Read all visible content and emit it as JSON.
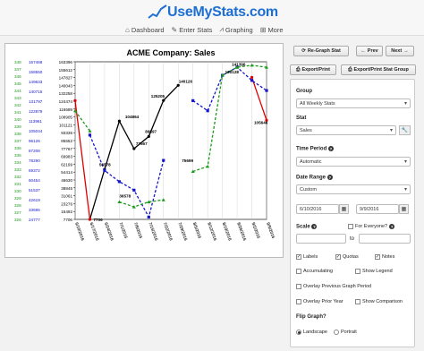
{
  "brand": {
    "name": "UseMyStats.com",
    "color": "#1d6fd1"
  },
  "nav": [
    {
      "label": "Dashboard",
      "icon": "home-icon"
    },
    {
      "label": "Enter Stats",
      "icon": "edit-icon"
    },
    {
      "label": "Graphing",
      "icon": "chart-icon"
    },
    {
      "label": "More",
      "icon": "plus-icon"
    }
  ],
  "toolbar": {
    "regraph": "Re-Graph Stat",
    "prev": "Prev",
    "next": "Next",
    "export_print": "Export/Print",
    "export_group": "Export/Print Stat Group"
  },
  "form": {
    "group_label": "Group",
    "group_value": "All Weekly Stats",
    "stat_label": "Stat",
    "stat_value": "Sales",
    "time_period_label": "Time Period",
    "time_period_value": "Automatic",
    "date_range_label": "Date Range",
    "date_range_value": "Custom",
    "date_from": "6/10/2016",
    "date_to": "9/9/2016",
    "scale_label": "Scale",
    "for_everyone_label": "For Everyone?",
    "scale_to": "to",
    "labels": "Labels",
    "quotas": "Quotas",
    "notes": "Notes",
    "accumulating": "Accumulating",
    "show_legend": "Show Legend",
    "overlay_prev": "Overlay Previous Graph Period",
    "overlay_prior_year": "Overlay Prior Year",
    "show_comparison": "Show Comparison",
    "flip_graph": "Flip Graph?",
    "landscape": "Landscape",
    "portrait": "Portrait"
  },
  "chart_data": {
    "type": "line",
    "title": "ACME Company: Sales",
    "categories": [
      "6/10/2016",
      "6/17/2016",
      "6/24/2016",
      "7/1/2016",
      "7/8/2016",
      "7/15/2016",
      "7/22/2016",
      "7/29/2016",
      "8/5/2016",
      "8/12/2016",
      "8/19/2016",
      "8/26/2016",
      "9/2/2016",
      "9/9/2016"
    ],
    "ylim": [
      7706,
      163396
    ],
    "yticks_main": [
      "163396",
      "155612",
      "147827",
      "140043",
      "132258",
      "124474",
      "116689",
      "108905",
      "101121",
      "93336",
      "85552",
      "77767",
      "69983",
      "62199",
      "54414",
      "46630",
      "38845",
      "31061",
      "23276",
      "15492",
      "7706"
    ],
    "yticks_left1": [
      "24777",
      "33695",
      "42619",
      "51537",
      "60454",
      "69372",
      "78290",
      "87208",
      "96126",
      "105044",
      "113961",
      "122879",
      "131797",
      "140715",
      "149633",
      "158550",
      "167468"
    ],
    "yticks_left2": [
      "348",
      "347",
      "346",
      "345",
      "344",
      "343",
      "342",
      "341",
      "340",
      "339",
      "338",
      "337",
      "336",
      "335",
      "334",
      "333",
      "332",
      "331",
      "330",
      "329",
      "328",
      "327",
      "326"
    ],
    "series": [
      {
        "name": "",
        "color": "#000000",
        "style": "solid",
        "values": [
          null,
          7706,
          57000,
          104864,
          77567,
          89597,
          125205,
          140126,
          null,
          null,
          null,
          null,
          null,
          null
        ]
      },
      {
        "name": "",
        "color": "#e00000",
        "style": "solid",
        "values": [
          125000,
          7706,
          null,
          null,
          null,
          null,
          null,
          null,
          null,
          null,
          null,
          null,
          148000,
          105646
        ]
      },
      {
        "name": "",
        "color": "#1515cc",
        "style": "dashed",
        "values": [
          null,
          91000,
          56000,
          45000,
          36578,
          10000,
          66000,
          null,
          125000,
          115000,
          150000,
          158000,
          145000,
          135000
        ]
      },
      {
        "name": "",
        "color": "#1a9a1a",
        "style": "dashed",
        "values": [
          115000,
          95000,
          null,
          25000,
          20000,
          25000,
          27000,
          null,
          55000,
          60000,
          150000,
          158000,
          160000,
          158000
        ]
      }
    ],
    "labels": {
      "l1": "160128",
      "l2": "107964",
      "l3": "104864",
      "l4": "125205",
      "l5": "140126",
      "l6": "141396",
      "l7": "155879",
      "l8": "105646",
      "l9": "77567",
      "l10": "89597",
      "l11": "56578",
      "l12": "7706",
      "l13": "36578",
      "l14": "75699"
    }
  }
}
